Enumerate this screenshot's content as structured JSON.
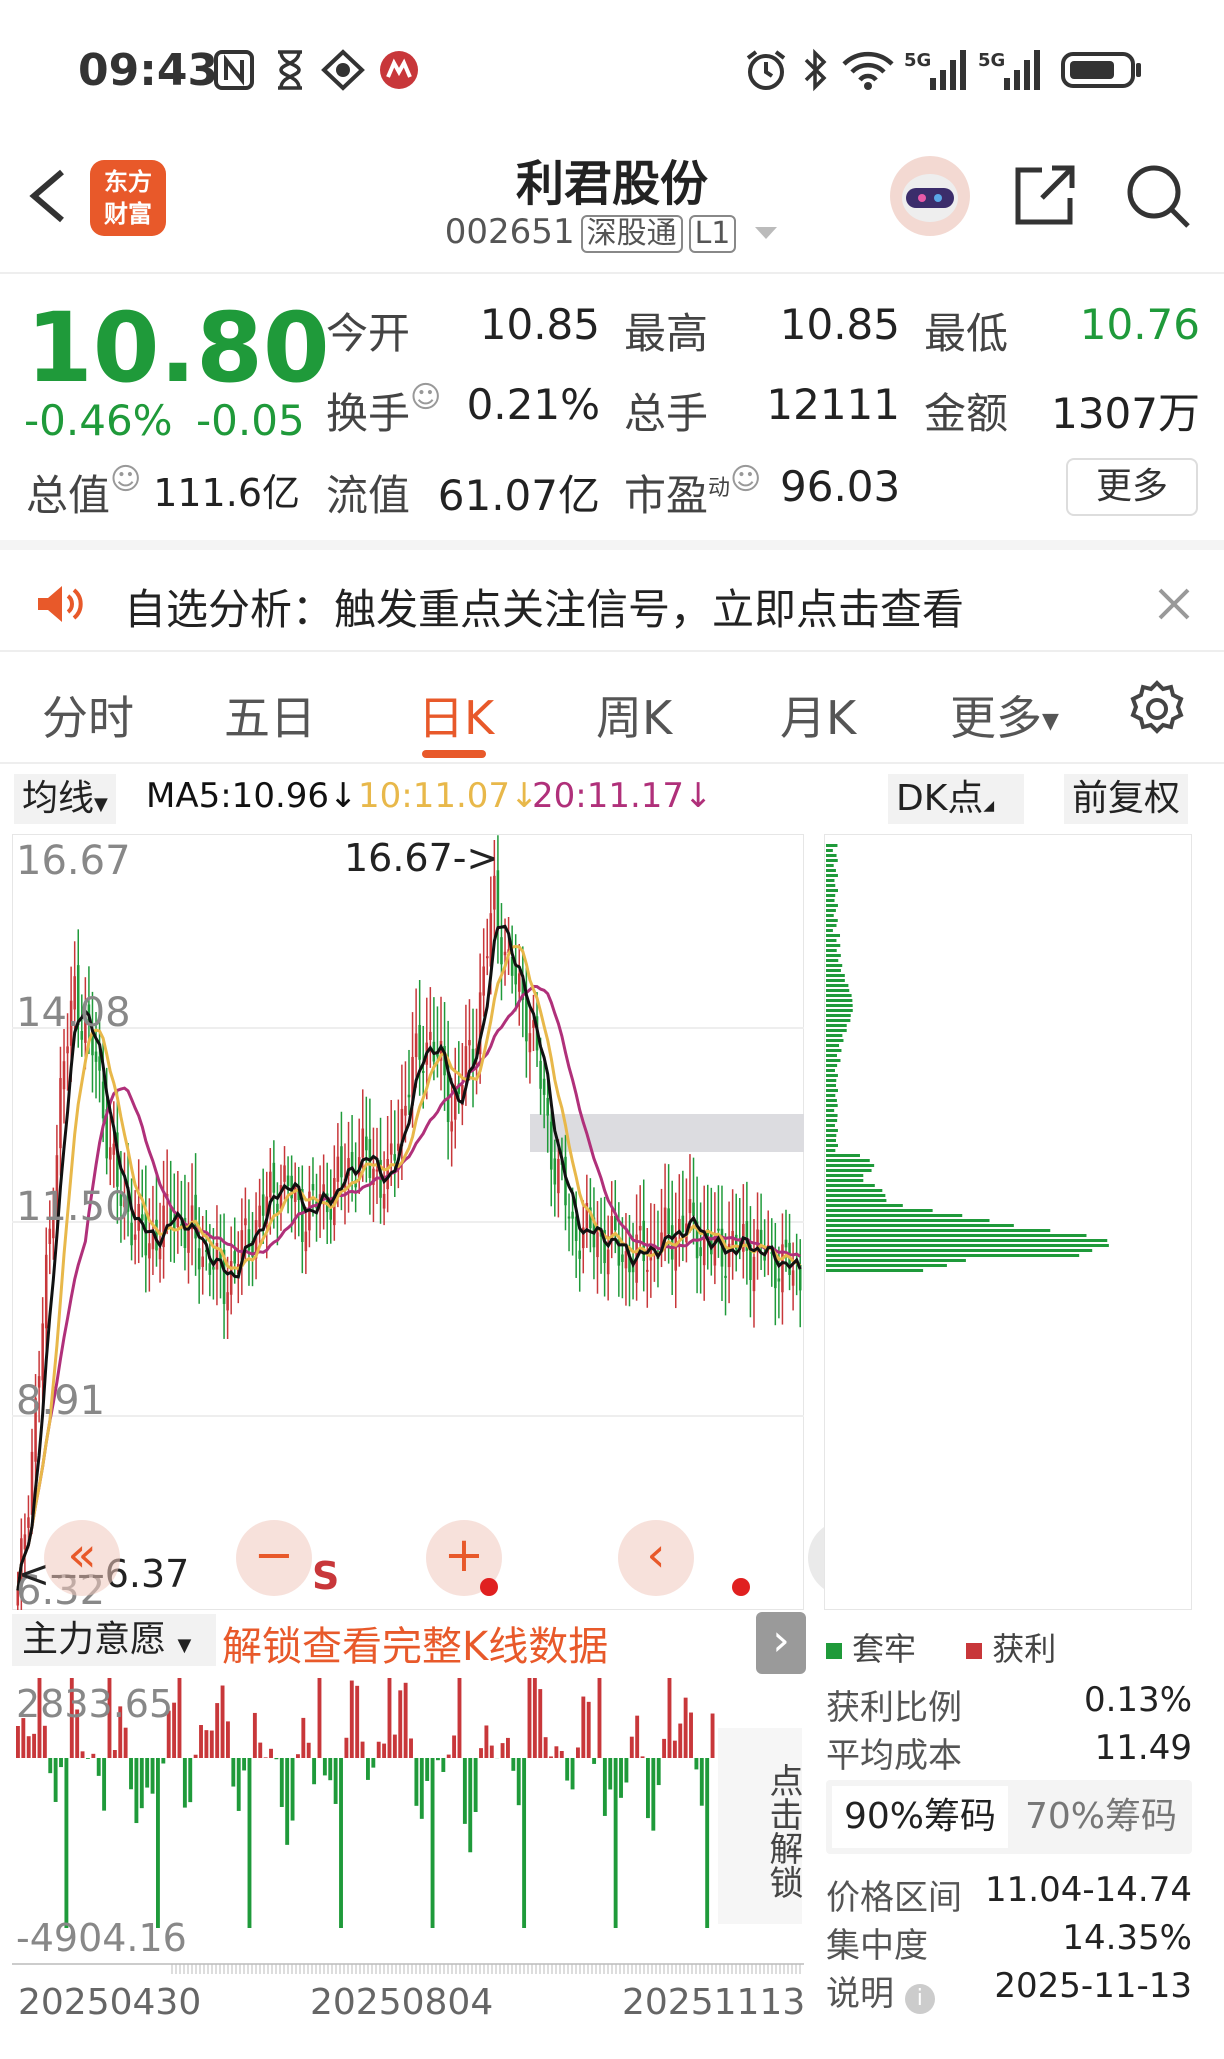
{
  "status_bar": {
    "time": "09:43"
  },
  "header": {
    "logo_text": "东方\n财富",
    "title": "利君股份",
    "code": "002651",
    "tag1": "深股通",
    "tag2": "L1"
  },
  "quote": {
    "price": "10.80",
    "change_pct": "-0.46%",
    "change_abs": "-0.05",
    "open_label": "今开",
    "open": "10.85",
    "high_label": "最高",
    "high": "10.85",
    "low_label": "最低",
    "low": "10.76",
    "turnover_label": "换手",
    "turnover": "0.21%",
    "volume_label": "总手",
    "volume": "12111",
    "amount_label": "金额",
    "amount": "1307万",
    "mcap_label": "总值",
    "mcap": "111.6亿",
    "float_label": "流值",
    "float": "61.07亿",
    "pe_label": "市盈",
    "pe_sup": "动",
    "pe": "96.03",
    "more": "更多"
  },
  "notice": {
    "text": "自选分析：触发重点关注信号，立即点击查看"
  },
  "tabs": [
    {
      "label": "分时"
    },
    {
      "label": "五日"
    },
    {
      "label": "日K"
    },
    {
      "label": "周K"
    },
    {
      "label": "月K"
    },
    {
      "label": "更多"
    }
  ],
  "chart_tools": {
    "ma_select": "均线",
    "ma5": "MA5:10.96↓",
    "ma10": "10:11.07↓",
    "ma20": "20:11.17↓",
    "dk": "DK点",
    "adjust": "前复权"
  },
  "kline": {
    "axis": [
      "16.67",
      "14.08",
      "11.50",
      "8.91",
      "6.32"
    ],
    "high_marker": "16.67->",
    "low_marker": "<----6.37",
    "s_marker": "S"
  },
  "indicator": {
    "name": "主力意愿",
    "unlock": "解锁查看完整K线数据",
    "axis_top": "2833.65",
    "axis_bottom": "-4904.16",
    "side_text": "点击解锁",
    "dates": [
      "20250430",
      "20250804",
      "20251113"
    ]
  },
  "chips": {
    "legend_trap": "套牢",
    "legend_profit": "获利",
    "profit_ratio_label": "获利比例",
    "profit_ratio": "0.13%",
    "avg_cost_label": "平均成本",
    "avg_cost": "11.49",
    "tab90": "90%筹码",
    "tab70": "70%筹码",
    "range_label": "价格区间",
    "range": "11.04-14.74",
    "conc_label": "集中度",
    "conc": "14.35%",
    "note_label": "说明",
    "note": "2025-11-13"
  },
  "colors": {
    "up": "#c8373a",
    "down": "#1f9a3a",
    "accent": "#e8592a",
    "ma5": "#111111",
    "ma10": "#e8b84a",
    "ma20": "#b0307a"
  },
  "chart_data": {
    "type": "candlestick",
    "x": [
      "20250430",
      "20250804",
      "20251113"
    ],
    "ylim": [
      6.32,
      16.67
    ],
    "ma5": 10.96,
    "ma10": 11.07,
    "ma20": 11.17,
    "high": 16.67,
    "low": 6.37
  }
}
